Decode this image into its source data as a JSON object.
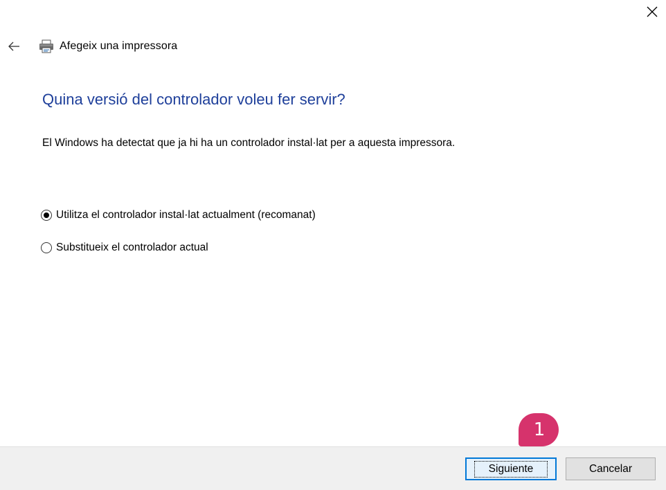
{
  "window": {
    "title": "Afegeix una impressora",
    "close_icon": "close-icon",
    "back_icon": "back-arrow-icon",
    "app_icon": "printer-icon"
  },
  "content": {
    "heading": "Quina versió del controlador voleu fer servir?",
    "description": "El Windows ha detectat que ja hi ha un controlador instal·lat per a aquesta impressora.",
    "options": [
      {
        "label": "Utilitza el controlador instal·lat actualment (recomanat)",
        "selected": true
      },
      {
        "label": "Substitueix el controlador actual",
        "selected": false
      }
    ]
  },
  "footer": {
    "next_label": "Siguiente",
    "cancel_label": "Cancelar"
  },
  "annotation": {
    "step_number": "1",
    "color": "#d6336c"
  },
  "colors": {
    "heading": "#1e3f9a",
    "focus_border": "#0078d7",
    "footer_bg": "#f0f0f0"
  }
}
